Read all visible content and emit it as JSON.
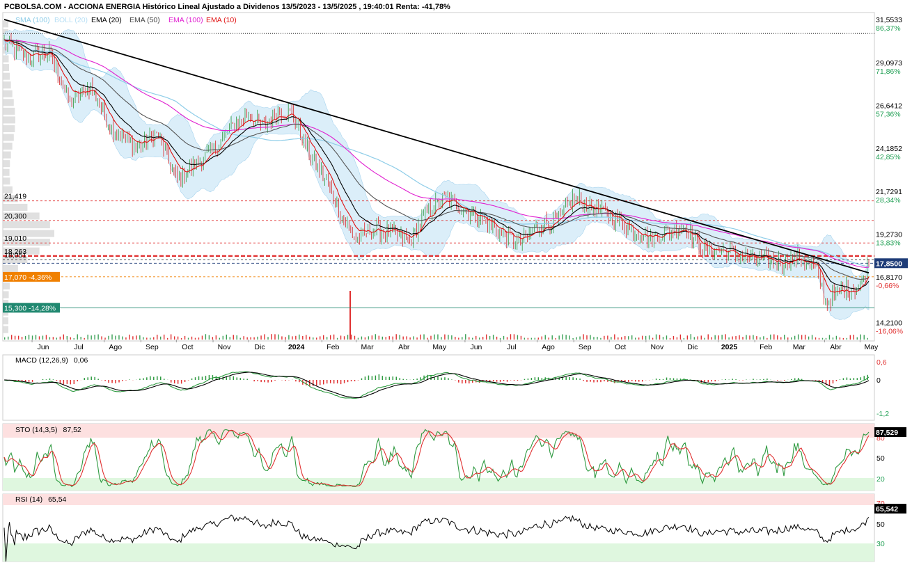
{
  "header": {
    "title": "PCBOLSA.COM - ACCIONA ENERGIA Histórico Lineal Ajustado a Dividenos 13/5/2023 - 13/5/2025 , 19:40:01 Renta: -41,78%"
  },
  "legend": [
    {
      "label": "SMA (100)",
      "color": "#8ecde8"
    },
    {
      "label": "BOLL (20)",
      "color": "#b9e0f5"
    },
    {
      "label": "EMA (20)",
      "color": "#000000"
    },
    {
      "label": "EMA (50)",
      "color": "#444444"
    },
    {
      "label": "EMA (100)",
      "color": "#e020d0"
    },
    {
      "label": "EMA (10)",
      "color": "#e01010"
    }
  ],
  "price_axis": [
    {
      "price": 31.5533,
      "label": "31,5533",
      "pct": "86,37%",
      "pct_color": "#22a055"
    },
    {
      "price": 29.0973,
      "label": "29,0973",
      "pct": "71,86%",
      "pct_color": "#22a055"
    },
    {
      "price": 26.6412,
      "label": "26,6412",
      "pct": "57,36%",
      "pct_color": "#22a055"
    },
    {
      "price": 24.1852,
      "label": "24,1852",
      "pct": "42,85%",
      "pct_color": "#22a055"
    },
    {
      "price": 21.7291,
      "label": "21,7291",
      "pct": "28,34%",
      "pct_color": "#22a055"
    },
    {
      "price": 19.273,
      "label": "19,2730",
      "pct": "13,83%",
      "pct_color": "#22a055"
    },
    {
      "price": 16.817,
      "label": "16,8170",
      "pct": "-0,66%",
      "pct_color": "#e03030"
    },
    {
      "price": 14.21,
      "label": "14,2100",
      "pct": "-16,06%",
      "pct_color": "#e03030"
    }
  ],
  "level_lines": [
    {
      "price": 21.419,
      "label": "21,419",
      "color": "#e03030",
      "style": "dashed"
    },
    {
      "price": 20.3,
      "label": "20,300",
      "color": "#e03030",
      "style": "dashed"
    },
    {
      "price": 19.01,
      "label": "19,010",
      "color": "#e03030",
      "style": "dashed"
    },
    {
      "price": 18.263,
      "label": "18,263",
      "color": "#e03030",
      "style": "thick"
    },
    {
      "price": 18.051,
      "label": "18,051",
      "color": "#333333",
      "style": "dashed"
    },
    {
      "price": 17.07,
      "label": "17,070  -4,36%",
      "color": "#f08000",
      "style": "dashed"
    },
    {
      "price": 15.3,
      "label": "15,300  -14,28%",
      "color": "#208870",
      "style": "solid"
    }
  ],
  "current_price": {
    "price": 17.85,
    "label": "17,8500"
  },
  "top_dotted_price": 31.0,
  "months": [
    "Jun",
    "Jul",
    "Ago",
    "Sep",
    "Oct",
    "Nov",
    "Dic",
    "2024",
    "Feb",
    "Mar",
    "Abr",
    "May",
    "Jun",
    "Jul",
    "Ago",
    "Sep",
    "Oct",
    "Nov",
    "Dic",
    "2025",
    "Feb",
    "Mar",
    "Abr",
    "May"
  ],
  "macd": {
    "label": "MACD (12,26,9)",
    "value": "0,06",
    "ticks": [
      "0,6",
      "0",
      "-1,2"
    ]
  },
  "sto": {
    "label": "STO (14,3,5)",
    "value": "87,52",
    "current": "87,529",
    "ticks": [
      "80",
      "50",
      "20"
    ]
  },
  "rsi": {
    "label": "RSI (14)",
    "value": "65,54",
    "current": "65,542",
    "ticks": [
      "70",
      "50",
      "30"
    ]
  },
  "chart_data": {
    "type": "line",
    "title": "PCBOLSA.COM - ACCIONA ENERGIA Histórico Lineal Ajustado a Dividenos 13/5/2023 - 13/5/2025 , 19:40:01 Renta: -41,78%",
    "x_range": [
      "13/5/2023",
      "13/5/2025"
    ],
    "ylim": [
      13.4,
      32.2
    ],
    "price_keypoints": {
      "x": [
        "2023-05-13",
        "2023-06-01",
        "2023-06-20",
        "2023-07-08",
        "2023-07-25",
        "2023-08-12",
        "2023-09-01",
        "2023-09-20",
        "2023-10-06",
        "2023-10-20",
        "2023-11-08",
        "2023-11-22",
        "2023-12-05",
        "2023-12-18",
        "2023-12-30",
        "2024-01-12",
        "2024-01-25",
        "2024-02-08",
        "2024-02-22",
        "2024-03-05",
        "2024-03-20",
        "2024-04-05",
        "2024-04-20",
        "2024-05-04",
        "2024-05-20",
        "2024-06-05",
        "2024-06-20",
        "2024-07-05",
        "2024-07-22",
        "2024-08-08",
        "2024-08-25",
        "2024-09-05",
        "2024-09-20",
        "2024-10-05",
        "2024-10-22",
        "2024-11-08",
        "2024-11-25",
        "2024-12-08",
        "2024-12-25",
        "2025-01-08",
        "2025-01-25",
        "2025-02-10",
        "2025-02-28",
        "2025-03-15",
        "2025-03-30",
        "2025-04-07",
        "2025-04-20",
        "2025-05-05",
        "2025-05-13"
      ],
      "y": [
        30.5,
        29.6,
        29.9,
        27.0,
        28.0,
        25.6,
        24.5,
        25.2,
        22.6,
        23.4,
        24.5,
        25.7,
        26.4,
        25.6,
        26.6,
        26.4,
        24.2,
        22.7,
        20.6,
        19.2,
        19.8,
        19.6,
        19.1,
        20.8,
        21.6,
        20.9,
        20.4,
        19.6,
        19.0,
        20.0,
        20.4,
        21.6,
        21.0,
        20.6,
        19.9,
        19.3,
        19.7,
        20.0,
        18.5,
        18.6,
        18.2,
        18.0,
        17.9,
        18.2,
        17.4,
        15.6,
        16.3,
        16.5,
        17.85
      ]
    },
    "trendline": {
      "start": {
        "x": "2023-05-13",
        "y": 31.8
      },
      "end": {
        "x": "2025-05-13",
        "y": 17.3
      }
    },
    "series": [
      {
        "name": "EMA (10)",
        "color": "#e01010"
      },
      {
        "name": "EMA (20)",
        "color": "#000000"
      },
      {
        "name": "EMA (50)",
        "color": "#444444"
      },
      {
        "name": "EMA (100)",
        "color": "#e020d0"
      },
      {
        "name": "SMA (100)",
        "color": "#8ecde8"
      },
      {
        "name": "BOLL (20)",
        "color": "#b9e0f5"
      }
    ],
    "last_value": 17.85
  }
}
